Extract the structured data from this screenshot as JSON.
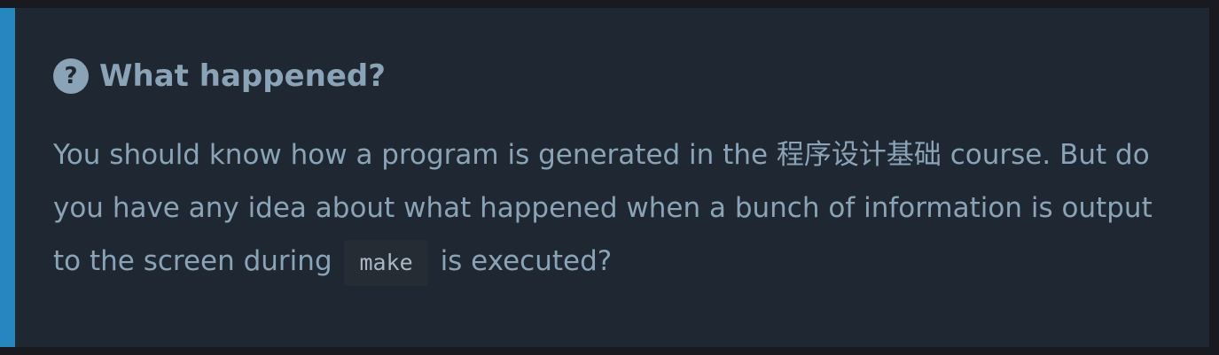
{
  "callout": {
    "title": "What happened?",
    "icon": "question-circle-icon",
    "accent_color": "#2687c0",
    "text_before_code": "You should know how a program is generated in the 程序设计基础 course. But do you have any idea about what happened when a bunch of information is output to the screen during",
    "code": "make",
    "text_after_code": "is executed?"
  }
}
